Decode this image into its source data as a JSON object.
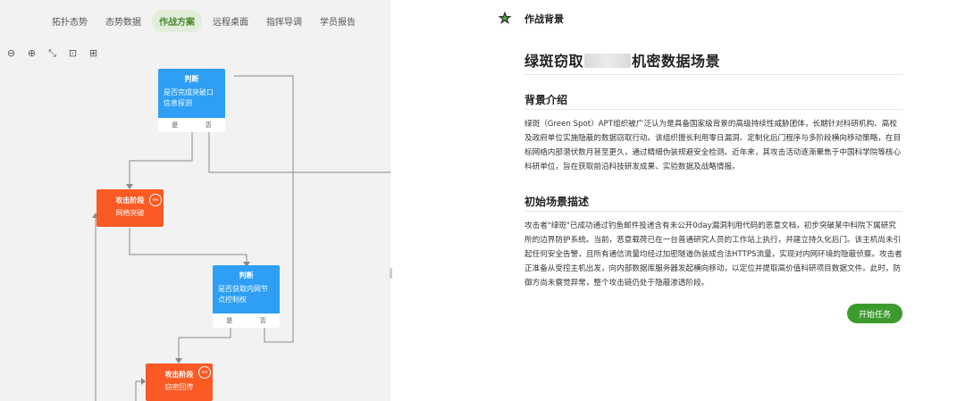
{
  "tabs": [
    {
      "label": "拓扑态势",
      "active": false
    },
    {
      "label": "态势数据",
      "active": false
    },
    {
      "label": "作战方案",
      "active": true
    },
    {
      "label": "远程桌面",
      "active": false
    },
    {
      "label": "指挥导调",
      "active": false
    },
    {
      "label": "学员报告",
      "active": false
    }
  ],
  "toolbar": {
    "zoom_out_icon": "⊖",
    "zoom_in_icon": "⊕",
    "fit_icon": "⤡",
    "fullscreen_icon": "⊡",
    "grid_icon": "⊞"
  },
  "flow": {
    "node1": {
      "title": "判断",
      "body": "是否完成突破口信息探测",
      "yes": "是",
      "no": "否"
    },
    "node2": {
      "title": "攻击阶段",
      "body": "网络突破"
    },
    "node3": {
      "title": "判断",
      "body": "是否获取内网节点控制权",
      "yes": "是",
      "no": "否"
    },
    "node4": {
      "title": "攻击阶段",
      "body": "窃密回传"
    }
  },
  "right": {
    "header": "作战背景",
    "title_part1": "绿斑窃取",
    "title_part2": "机密数据场景",
    "sec1": "背景介绍",
    "para1": "绿斑（Green Spot）APT组织被广泛认为是具备国家级背景的高级持续性威胁团体，长期针对科研机构、高校及政府单位实施隐蔽的数据窃取行动。该组织擅长利用零日漏洞、定制化后门程序与多阶段横向移动策略，在目标网络内部潜伏数月甚至更久，通过精细伪装规避安全检测。近年来，其攻击活动逐渐聚焦于中国科学院等核心科研单位，旨在获取前沿科技研发成果、实验数据及战略情报。",
    "sec2": "初始场景描述",
    "para2": "攻击者\"绿斑\"已成功通过钓鱼邮件投递含有未公开0day漏洞利用代码的恶意文档，初步突破某中科院下属研究所的边界防护系统。当前，恶意载荷已在一台普通研究人员的工作站上执行，并建立持久化后门。该主机尚未引起任何安全告警，且所有通信流量均经过加密隧道伪装成合法HTTPS流量，实现对内网环境的隐蔽侦察。攻击者正准备从受控主机出发，向内部数据库服务器发起横向移动，以定位并提取高价值科研项目数据文件。此时，防御方尚未察觉异常，整个攻击链仍处于隐蔽渗透阶段。",
    "start_button": "开始任务"
  },
  "colors": {
    "accent": "#3d9b2e",
    "node_blue": "#2e9ff5",
    "node_orange": "#fa5a23",
    "tab_active_bg": "#e3eddc"
  }
}
